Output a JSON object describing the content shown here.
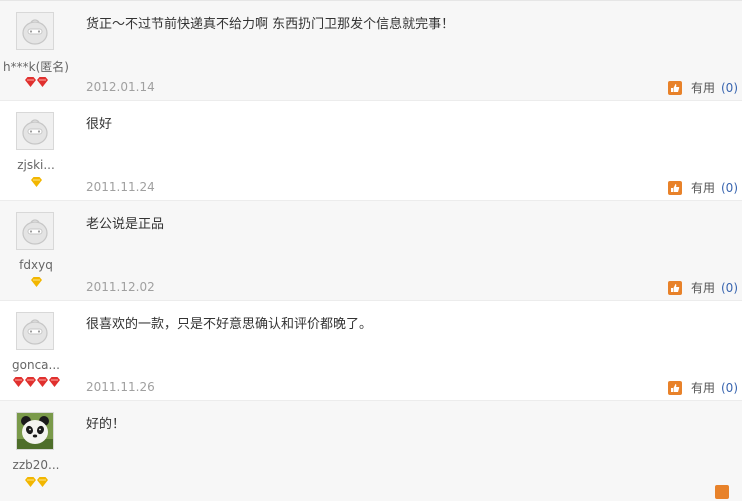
{
  "reviews": [
    {
      "user": "h***k(匿名)",
      "content": "货正～不过节前快递真不给力啊 东西扔门卫那发个信息就完事！",
      "date": "2012.01.14",
      "useful_label": "有用",
      "useful_count": "(0)",
      "badge": "red",
      "badge_count": 2,
      "avatar": "default-avatar"
    },
    {
      "user": "zjski...",
      "content": "很好",
      "date": "2011.11.24",
      "useful_label": "有用",
      "useful_count": "(0)",
      "badge": "yellow",
      "badge_count": 1,
      "avatar": "default-avatar"
    },
    {
      "user": "fdxyq",
      "content": "老公说是正品",
      "date": "2011.12.02",
      "useful_label": "有用",
      "useful_count": "(0)",
      "badge": "yellow",
      "badge_count": 1,
      "avatar": "default-avatar"
    },
    {
      "user": "gonca...",
      "content": "很喜欢的一款，只是不好意思确认和评价都晚了。",
      "date": "2011.11.26",
      "useful_label": "有用",
      "useful_count": "(0)",
      "badge": "red",
      "badge_count": 4,
      "avatar": "default-avatar"
    },
    {
      "user": "zzb20...",
      "content": "好的！",
      "date": "",
      "useful_label": "",
      "useful_count": "",
      "badge": "yellow",
      "badge_count": 2,
      "avatar": "panda-avatar"
    }
  ],
  "colors": {
    "red_badge": "#e0302e",
    "yellow_badge": "#f2b600",
    "thumb": "#e8822a",
    "count_link": "#3a66b0"
  }
}
